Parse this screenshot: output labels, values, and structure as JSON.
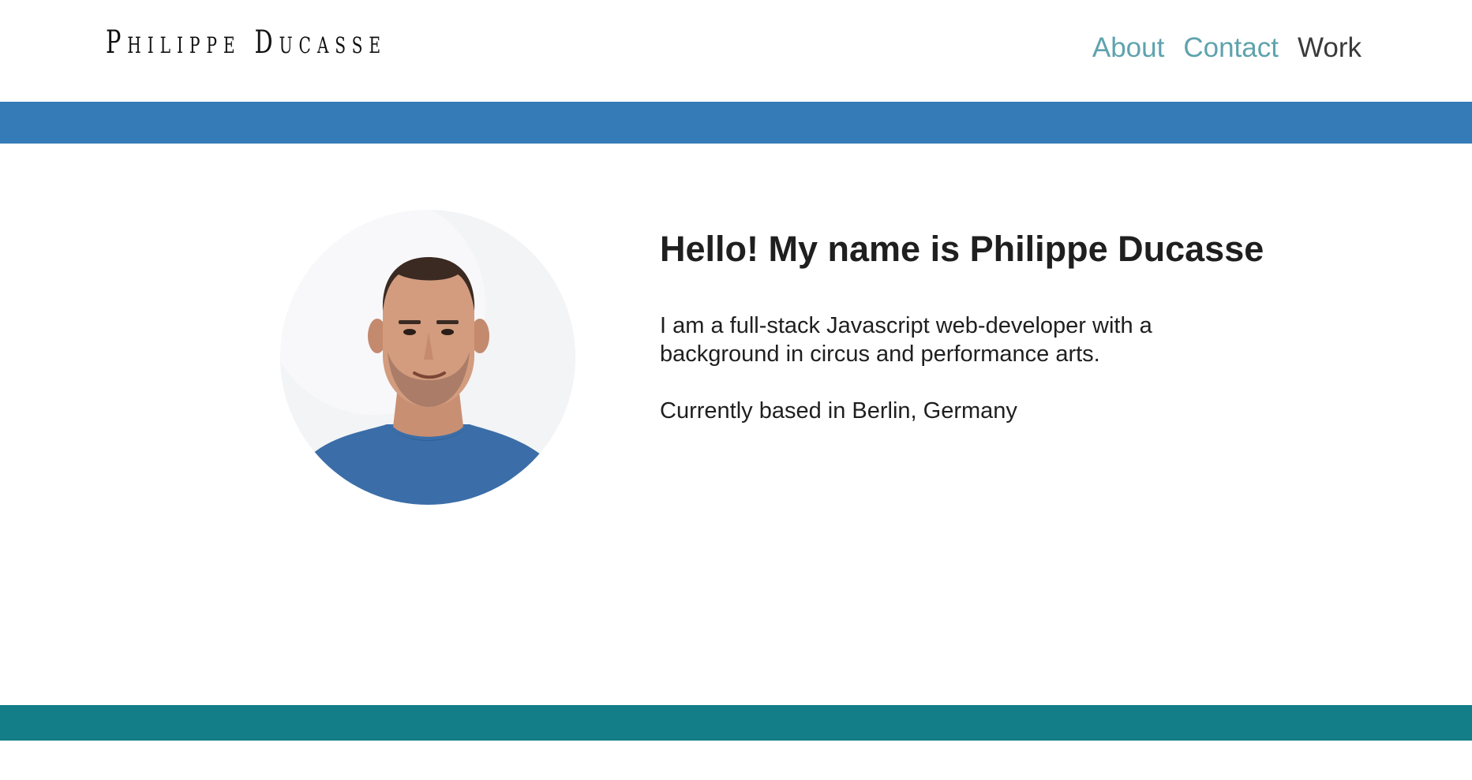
{
  "brand": {
    "name": "Philippe Ducasse"
  },
  "nav": {
    "items": [
      {
        "label": "About",
        "color": "#5ea3ad"
      },
      {
        "label": "Contact",
        "color": "#5ea3ad"
      },
      {
        "label": "Work",
        "color": "#3a3a3a"
      }
    ]
  },
  "colors": {
    "top_band": "#347bb8",
    "bottom_band": "#137e87",
    "shirt": "#3b6ea8",
    "background": "#ffffff"
  },
  "profile": {
    "photo_icon": "portrait-photo",
    "heading": "Hello! My name is Philippe Ducasse",
    "bio": "I am a full-stack Javascript web-developer with a background in circus and performance arts.",
    "location": "Currently based in Berlin, Germany"
  }
}
